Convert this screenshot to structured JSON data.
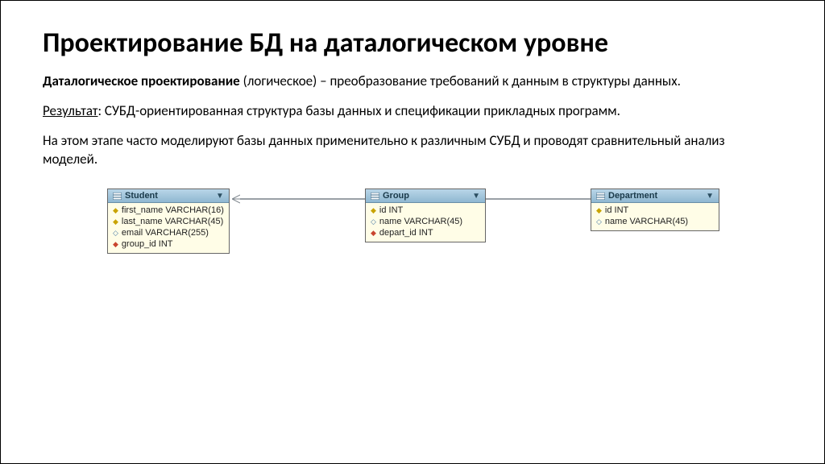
{
  "title": "Проектирование БД на даталогическом уровне",
  "paragraphs": {
    "p1_bold": "Даталогическое проектирование",
    "p1_rest": " (логическое) – преобразование требований к данным в структуры данных.",
    "p2_label": "Результат",
    "p2_rest": ": СУБД-ориентированная структура базы данных и спецификации прикладных программ.",
    "p3": "На этом этапе часто моделируют базы данных применительно к различным СУБД и проводят сравнительный анализ моделей."
  },
  "chart_data": {
    "type": "erd",
    "entities": [
      {
        "id": "student",
        "name": "Student",
        "columns": [
          {
            "icon": "key",
            "text": "first_name VARCHAR(16)"
          },
          {
            "icon": "key",
            "text": "last_name VARCHAR(45)"
          },
          {
            "icon": "col",
            "text": "email VARCHAR(255)"
          },
          {
            "icon": "fk",
            "text": "group_id INT"
          }
        ]
      },
      {
        "id": "group",
        "name": "Group",
        "columns": [
          {
            "icon": "key",
            "text": "id INT"
          },
          {
            "icon": "col",
            "text": "name VARCHAR(45)"
          },
          {
            "icon": "fk",
            "text": "depart_id INT"
          }
        ]
      },
      {
        "id": "department",
        "name": "Department",
        "columns": [
          {
            "icon": "key",
            "text": "id INT"
          },
          {
            "icon": "col",
            "text": "name VARCHAR(45)"
          }
        ]
      }
    ],
    "relationships": [
      {
        "from": "student",
        "to": "group",
        "type": "many-to-one"
      },
      {
        "from": "group",
        "to": "department",
        "type": "many-to-one"
      }
    ]
  }
}
